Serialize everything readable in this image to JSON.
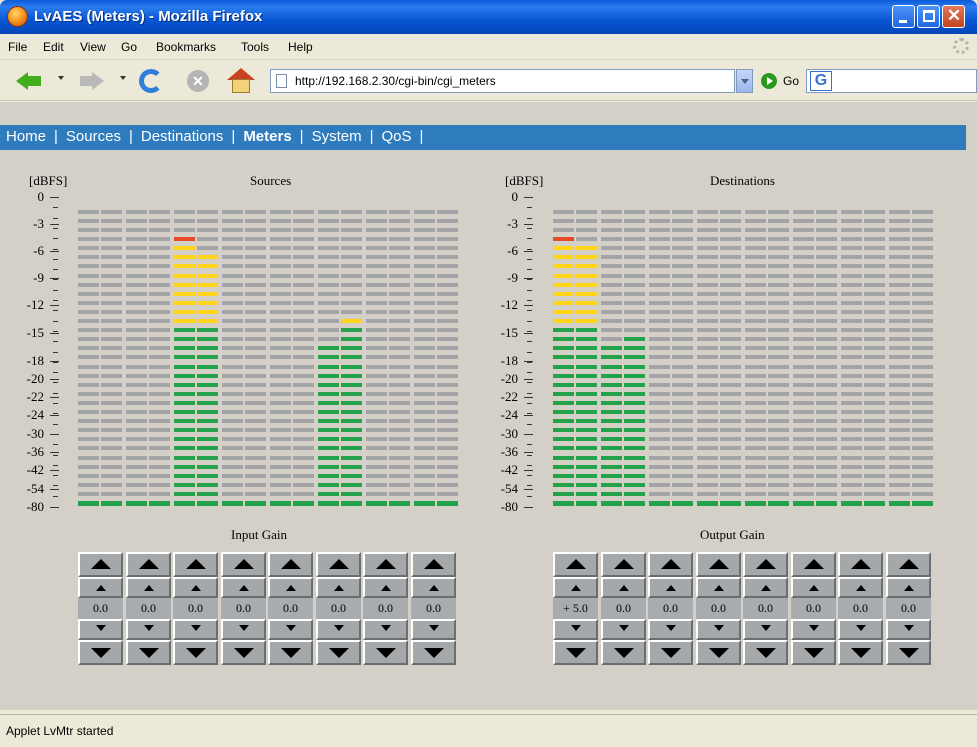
{
  "window": {
    "title": "LvAES (Meters) - Mozilla Firefox"
  },
  "menu": [
    "File",
    "Edit",
    "View",
    "Go",
    "Bookmarks",
    "Tools",
    "Help"
  ],
  "toolbar": {
    "url": "http://192.168.2.30/cgi-bin/cgi_meters",
    "go_label": "Go",
    "search_logo": "G"
  },
  "sitenav": {
    "links": [
      "Home",
      "Sources",
      "Destinations",
      "Meters",
      "System",
      "QoS"
    ],
    "active": "Meters"
  },
  "meters": {
    "unit_label": "[dBFS]",
    "scale_labels": [
      "0",
      "-3",
      "-6",
      "-9",
      "-12",
      "-15",
      "-18",
      "-20",
      "-22",
      "-24",
      "-30",
      "-36",
      "-42",
      "-54",
      "-80"
    ],
    "segment_colors": {
      "off": "#a2a4a6",
      "green": "#22a24a",
      "yellow": "#ffd51a",
      "red": "#e84a28"
    },
    "panels": [
      {
        "title": "Sources",
        "lit_segments": [
          1,
          1,
          1,
          1,
          30,
          28,
          1,
          1,
          1,
          1,
          18,
          20,
          1,
          1,
          1,
          1
        ],
        "peak_hold": [
          null,
          null,
          null,
          null,
          null,
          null,
          null,
          null,
          null,
          null,
          null,
          21,
          null,
          null,
          null,
          null
        ]
      },
      {
        "title": "Destinations",
        "lit_segments": [
          30,
          29,
          18,
          19,
          1,
          1,
          1,
          1,
          1,
          1,
          1,
          1,
          1,
          1,
          1,
          1
        ],
        "peak_hold": [
          null,
          null,
          null,
          null,
          null,
          null,
          null,
          null,
          null,
          null,
          null,
          null,
          null,
          null,
          null,
          null
        ]
      }
    ]
  },
  "gain": {
    "input": {
      "title": "Input Gain",
      "values": [
        "0.0",
        "0.0",
        "0.0",
        "0.0",
        "0.0",
        "0.0",
        "0.0",
        "0.0"
      ]
    },
    "output": {
      "title": "Output Gain",
      "values": [
        "+ 5.0",
        "0.0",
        "0.0",
        "0.0",
        "0.0",
        "0.0",
        "0.0",
        "0.0"
      ]
    }
  },
  "status": {
    "text": "Applet LvMtr started"
  }
}
